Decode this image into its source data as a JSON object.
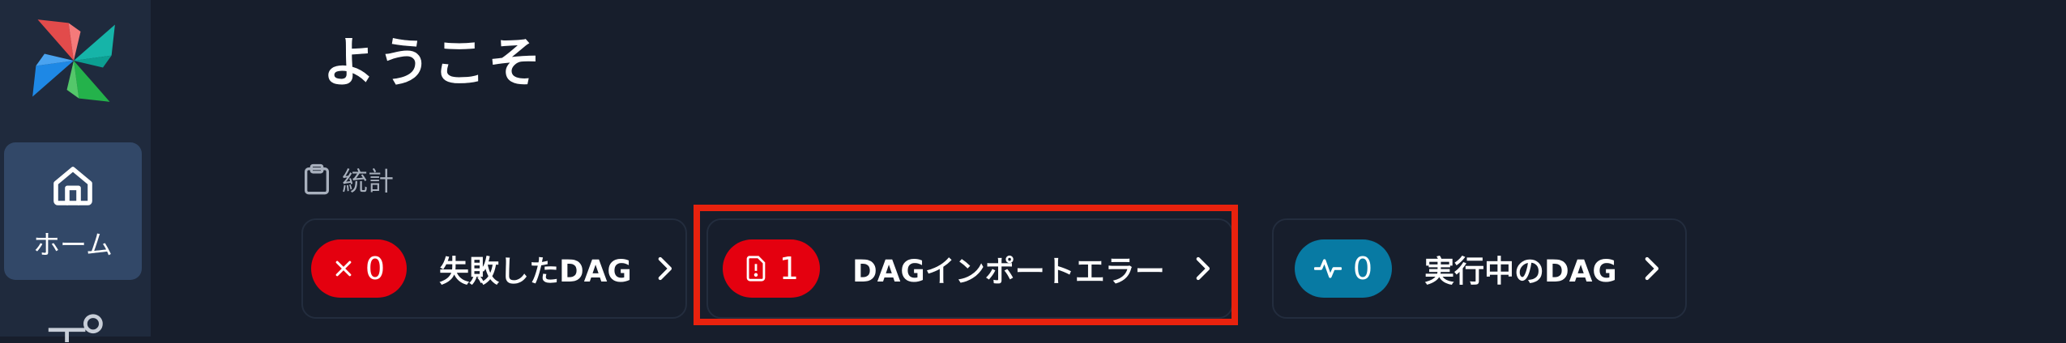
{
  "sidebar": {
    "home_label": "ホーム"
  },
  "page": {
    "title": "ようこそ"
  },
  "stats": {
    "header": "統計",
    "cards": [
      {
        "count": "0",
        "label": "失敗したDAG",
        "badge_color": "#e4000f",
        "icon": "x-icon"
      },
      {
        "count": "1",
        "label": "DAGインポートエラー",
        "badge_color": "#e4000f",
        "icon": "file-alert-icon"
      },
      {
        "count": "0",
        "label": "実行中のDAG",
        "badge_color": "#087aa3",
        "icon": "activity-icon"
      }
    ]
  },
  "colors": {
    "background": "#171e2c",
    "sidebar": "#1f2a3d",
    "nav_active": "#324868",
    "highlight": "#e8220e"
  }
}
